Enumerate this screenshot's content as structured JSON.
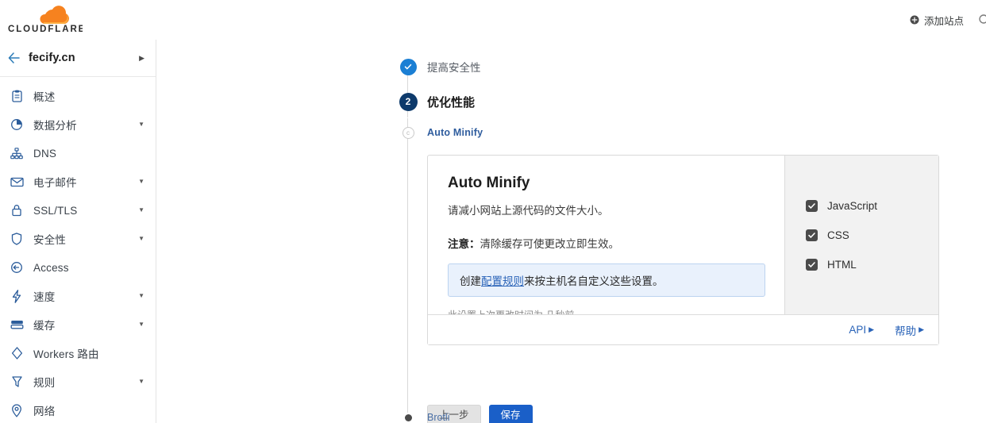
{
  "topbar": {
    "brand": "CLOUDFLARE",
    "add_site_label": "添加站点",
    "add_site_icon": "plus-circle-icon",
    "search_icon": "search-icon"
  },
  "sidebar": {
    "site": {
      "name": "fecify.cn",
      "back_icon": "arrow-left-icon",
      "chevron_icon": "chevron-right-icon"
    },
    "items": [
      {
        "label": "概述",
        "icon": "clipboard-icon",
        "caret": false
      },
      {
        "label": "数据分析",
        "icon": "pie-chart-icon",
        "caret": true
      },
      {
        "label": "DNS",
        "icon": "sitemap-icon",
        "caret": false
      },
      {
        "label": "电子邮件",
        "icon": "envelope-icon",
        "caret": true
      },
      {
        "label": "SSL/TLS",
        "icon": "lock-icon",
        "caret": true
      },
      {
        "label": "安全性",
        "icon": "shield-icon",
        "caret": true
      },
      {
        "label": "Access",
        "icon": "access-key-icon",
        "caret": false
      },
      {
        "label": "速度",
        "icon": "bolt-icon",
        "caret": true
      },
      {
        "label": "缓存",
        "icon": "database-icon",
        "caret": true
      },
      {
        "label": "Workers 路由",
        "icon": "workers-icon",
        "caret": false
      },
      {
        "label": "规则",
        "icon": "rules-icon",
        "caret": true
      },
      {
        "label": "网络",
        "icon": "location-pin-icon",
        "caret": false
      }
    ]
  },
  "stepper": {
    "steps": [
      {
        "label": "提高安全性",
        "state": "done",
        "marker": "check-icon"
      },
      {
        "label": "优化性能",
        "state": "current",
        "marker": "2"
      },
      {
        "label": "Auto Minify",
        "state": "active-sub",
        "marker": "c"
      },
      {
        "label": "Brotli",
        "state": "pending",
        "marker": "dot"
      }
    ]
  },
  "card": {
    "title": "Auto Minify",
    "description": "请减小网站上源代码的文件大小。",
    "note_prefix": "注意：",
    "note_text": "清除缓存可使更改立即生效。",
    "banner": {
      "before": "创建",
      "link": "配置规则",
      "after": "来按主机名自定义这些设置。"
    },
    "meta": "此设置上次更改时间为 几秒前",
    "options": [
      {
        "label": "JavaScript",
        "checked": true
      },
      {
        "label": "CSS",
        "checked": true
      },
      {
        "label": "HTML",
        "checked": true
      }
    ],
    "footer": {
      "api_label": "API",
      "help_label": "帮助",
      "arrow": "▶"
    }
  },
  "actions": {
    "previous_label": "上一步",
    "save_label": "保存"
  },
  "colors": {
    "brand_orange": "#f6821f",
    "primary_blue": "#1a5fc8",
    "step_done": "#1b7fd4",
    "step_current": "#0d3a6b",
    "panel_gray": "#f2f2f2",
    "banner_bg": "#e9f1fc"
  }
}
